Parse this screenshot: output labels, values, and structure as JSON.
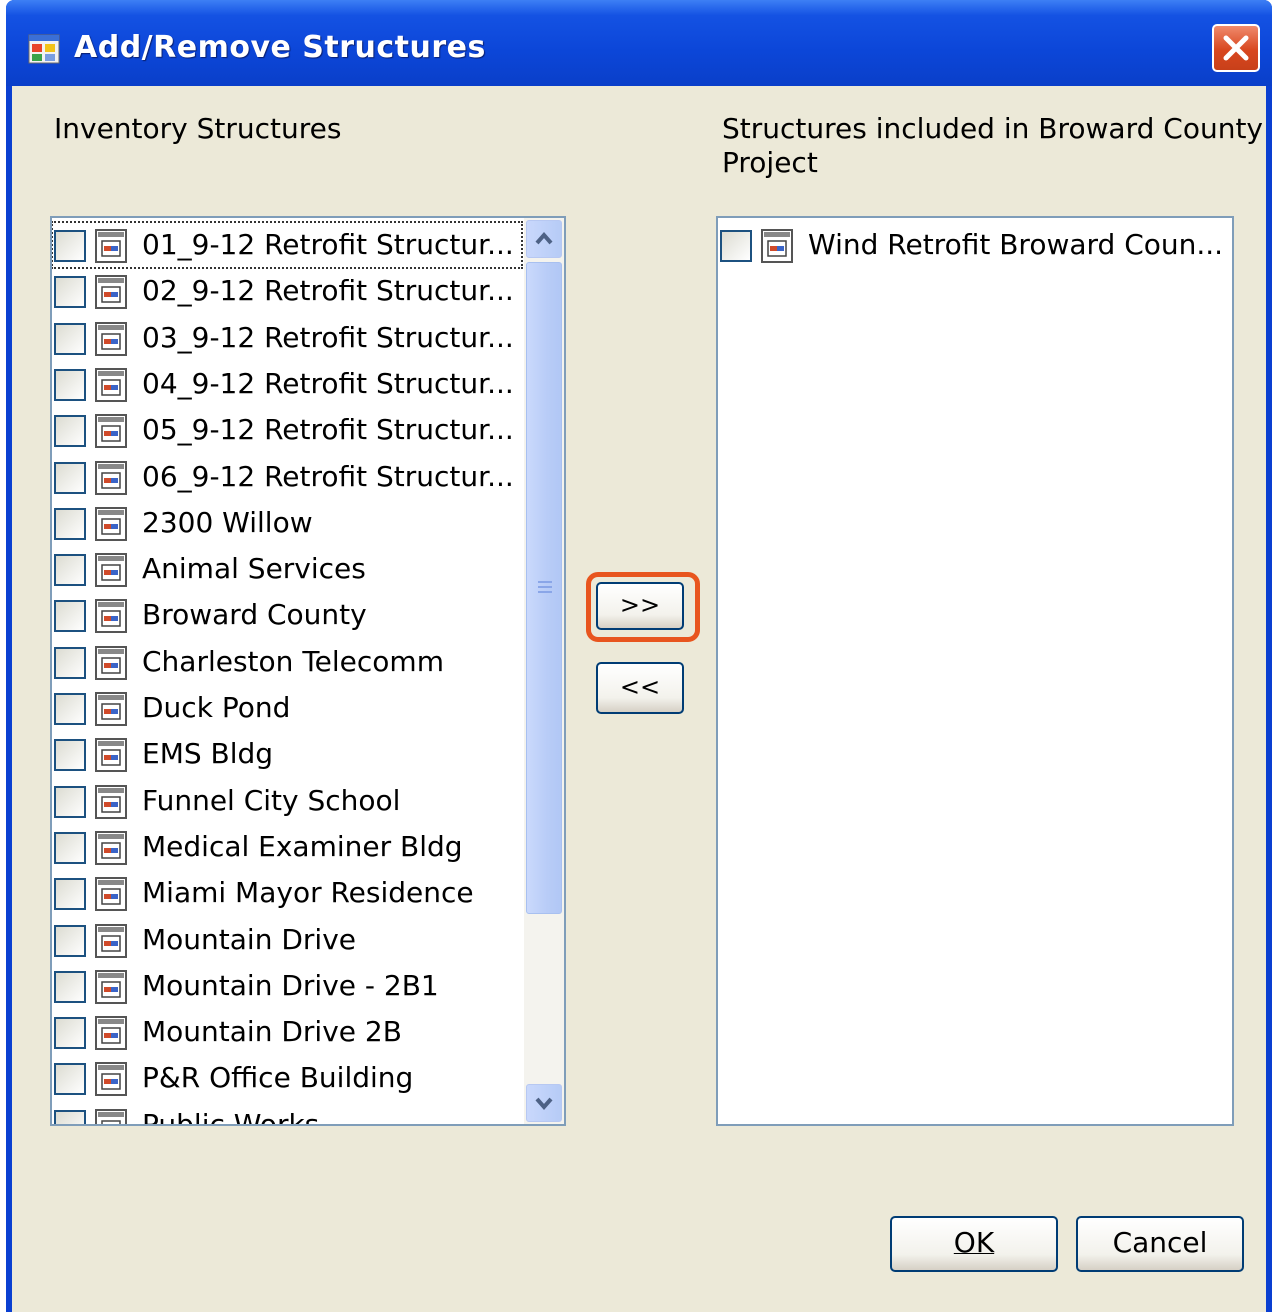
{
  "window": {
    "title": "Add/Remove Structures"
  },
  "left_list": {
    "label": "Inventory Structures",
    "items": [
      {
        "label": "01_9-12 Retrofit Structur...",
        "checked": false
      },
      {
        "label": "02_9-12 Retrofit Structur...",
        "checked": false
      },
      {
        "label": "03_9-12 Retrofit Structur...",
        "checked": false
      },
      {
        "label": "04_9-12 Retrofit Structur...",
        "checked": false
      },
      {
        "label": "05_9-12 Retrofit Structur...",
        "checked": false
      },
      {
        "label": "06_9-12 Retrofit Structur...",
        "checked": false
      },
      {
        "label": "2300 Willow",
        "checked": false
      },
      {
        "label": "Animal Services",
        "checked": false
      },
      {
        "label": "Broward County",
        "checked": false
      },
      {
        "label": "Charleston Telecomm",
        "checked": false
      },
      {
        "label": "Duck Pond",
        "checked": false
      },
      {
        "label": "EMS Bldg",
        "checked": false
      },
      {
        "label": "Funnel City School",
        "checked": false
      },
      {
        "label": "Medical Examiner Bldg",
        "checked": false
      },
      {
        "label": "Miami Mayor Residence",
        "checked": false
      },
      {
        "label": "Mountain Drive",
        "checked": false
      },
      {
        "label": "Mountain Drive - 2B1",
        "checked": false
      },
      {
        "label": "Mountain Drive 2B",
        "checked": false
      },
      {
        "label": "P&R Office Building",
        "checked": false
      },
      {
        "label": "Public Works",
        "checked": false
      }
    ]
  },
  "right_list": {
    "label_line1": "Structures included in Broward County",
    "label_line2": "Project",
    "items": [
      {
        "label": "Wind Retrofit Broward Coun...",
        "checked": false
      }
    ]
  },
  "buttons": {
    "add": ">>",
    "remove": "<<",
    "ok": "OK",
    "cancel": "Cancel"
  },
  "colors": {
    "title_bar": "#0a3fd1",
    "client_bg": "#ece9d8",
    "highlight": "#e8551e"
  },
  "icons": {
    "app": "app-window-icon",
    "close": "close-icon",
    "item": "structure-document-icon",
    "scroll_up": "chevron-up-icon",
    "scroll_down": "chevron-down-icon"
  }
}
